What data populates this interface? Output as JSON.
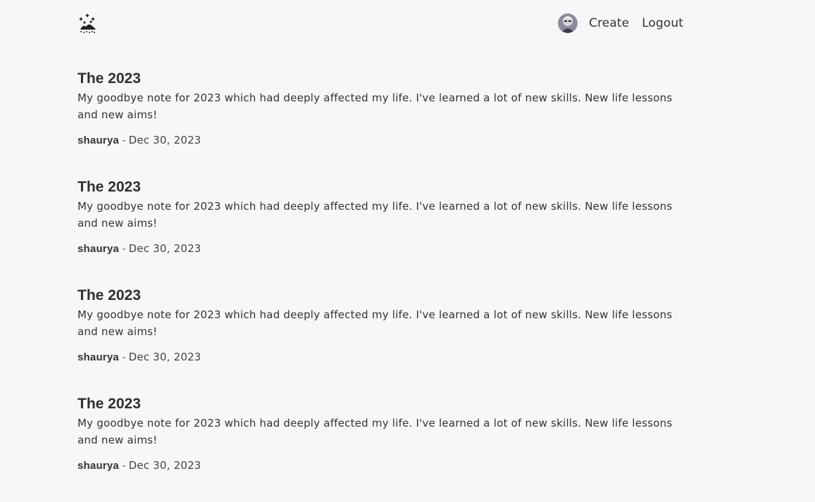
{
  "header": {
    "logo_icon": "starry-mountain-logo-icon",
    "avatar_icon": "user-avatar-icon",
    "nav": {
      "create": "Create",
      "logout": "Logout"
    }
  },
  "posts": [
    {
      "title": "The 2023",
      "excerpt": "My goodbye note for 2023 which had deeply affected my life. I've learned a lot of new skills. New life lessons and new aims!",
      "author": "shaurya",
      "separator": "-",
      "date": "Dec 30, 2023"
    },
    {
      "title": "The 2023",
      "excerpt": "My goodbye note for 2023 which had deeply affected my life. I've learned a lot of new skills. New life lessons and new aims!",
      "author": "shaurya",
      "separator": "-",
      "date": "Dec 30, 2023"
    },
    {
      "title": "The 2023",
      "excerpt": "My goodbye note for 2023 which had deeply affected my life. I've learned a lot of new skills. New life lessons and new aims!",
      "author": "shaurya",
      "separator": "-",
      "date": "Dec 30, 2023"
    },
    {
      "title": "The 2023",
      "excerpt": "My goodbye note for 2023 which had deeply affected my life. I've learned a lot of new skills. New life lessons and new aims!",
      "author": "shaurya",
      "separator": "-",
      "date": "Dec 30, 2023"
    }
  ]
}
